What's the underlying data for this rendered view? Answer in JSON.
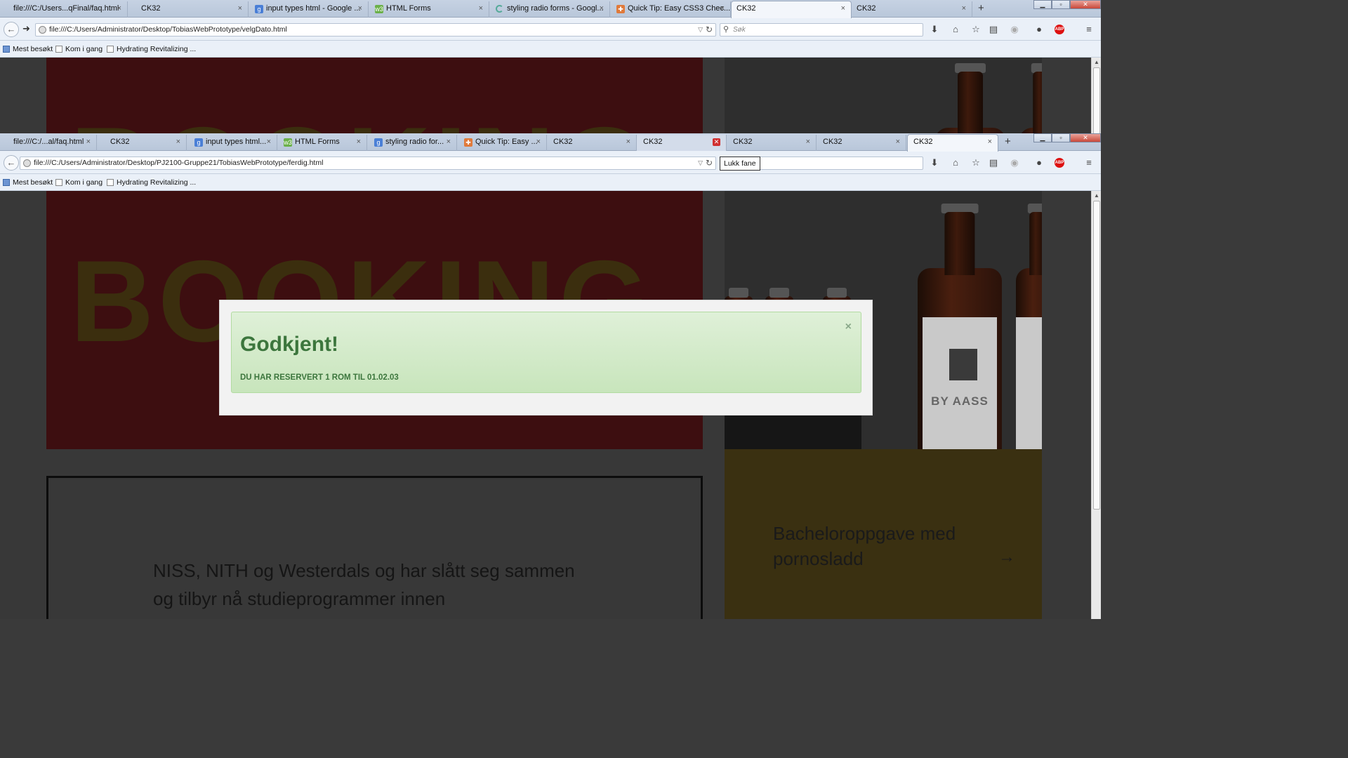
{
  "window1": {
    "tabs": [
      {
        "label": "file:///C:/Users...qFinal/faq.html",
        "icon": "none"
      },
      {
        "label": "CK32",
        "icon": "none"
      },
      {
        "label": "input types html - Google ...",
        "icon": "google"
      },
      {
        "label": "HTML Forms",
        "icon": "w3"
      },
      {
        "label": "styling radio forms - Googl...",
        "icon": "loading"
      },
      {
        "label": "Quick Tip: Easy CSS3 Chec...",
        "icon": "orange"
      },
      {
        "label": "CK32",
        "icon": "none"
      },
      {
        "label": "CK32",
        "icon": "none"
      }
    ],
    "url": "file:///C:/Users/Administrator/Desktop/TobiasWebPrototype/velgDato.html",
    "search_placeholder": "Søk"
  },
  "window2": {
    "tabs": [
      {
        "label": "file:///C:/...al/faq.html",
        "icon": "none"
      },
      {
        "label": "CK32",
        "icon": "none"
      },
      {
        "label": "input types html...",
        "icon": "google"
      },
      {
        "label": "HTML Forms",
        "icon": "w3"
      },
      {
        "label": "styling radio for...",
        "icon": "google"
      },
      {
        "label": "Quick Tip: Easy ...",
        "icon": "orange"
      },
      {
        "label": "CK32",
        "icon": "none"
      },
      {
        "label": "CK32",
        "icon": "none"
      },
      {
        "label": "CK32",
        "icon": "none"
      },
      {
        "label": "CK32",
        "icon": "none"
      },
      {
        "label": "CK32",
        "icon": "none"
      }
    ],
    "url": "file:///C:/Users/Administrator/Desktop/PJ2100-Gruppe21/TobiasWebPrototype/ferdig.html",
    "tooltip": "Lukk fane"
  },
  "bookmarks": [
    "Mest besøkt",
    "Kom i gang",
    "Hydrating Revitalizing ..."
  ],
  "page": {
    "hero_word": "BOOKING",
    "bottle_label": "BY AASS",
    "card_text": "Bacheloroppgave med pornosladd",
    "card_arrow": "→",
    "intro_text": "NISS, NITH og Westerdals og har slått seg sammen og tilbyr nå studieprogrammer innen"
  },
  "modal": {
    "title": "Godkjent!",
    "message": "DU HAR RESERVERT 1 ROM TIL 01.02.03",
    "close": "×"
  },
  "colors": {
    "alert_bg": "#dff0d8",
    "alert_text": "#3c763d",
    "hero_red": "#3d0e10"
  }
}
